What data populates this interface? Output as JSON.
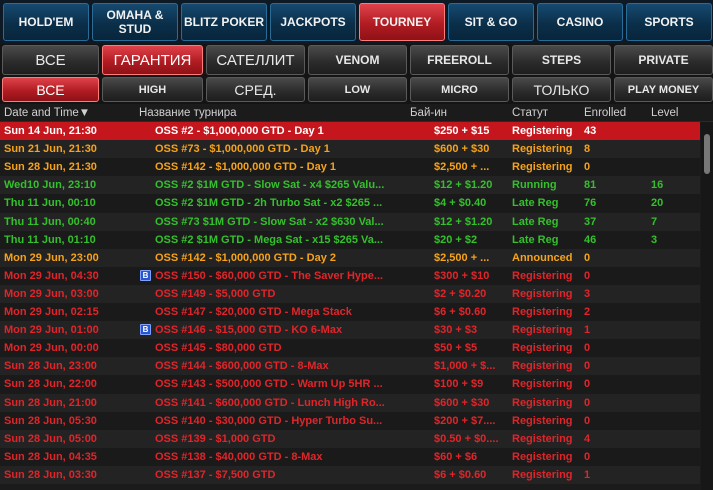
{
  "colors": {
    "orange": "#f6a21a",
    "green": "#34c02c",
    "red": "#e0252a",
    "white": "#ffffff"
  },
  "top_tabs": [
    {
      "label": "HOLD'EM",
      "active": false
    },
    {
      "label": "OMAHA & STUD",
      "active": false
    },
    {
      "label": "BLITZ POKER",
      "active": false
    },
    {
      "label": "JACKPOTS",
      "active": false
    },
    {
      "label": "TOURNEY",
      "active": true
    },
    {
      "label": "SIT & GO",
      "active": false
    },
    {
      "label": "CASINO",
      "active": false
    },
    {
      "label": "SPORTS",
      "active": false
    }
  ],
  "filters_row1": [
    {
      "label": "ВСЕ",
      "active": false,
      "big": true
    },
    {
      "label": "ГАРАНТИЯ",
      "active": true,
      "big": true
    },
    {
      "label": "САТЕЛЛИТ",
      "active": false,
      "big": true
    },
    {
      "label": "VENOM",
      "active": false,
      "big": false
    },
    {
      "label": "FREEROLL",
      "active": false,
      "big": false
    },
    {
      "label": "STEPS",
      "active": false,
      "big": false
    },
    {
      "label": "PRIVATE",
      "active": false,
      "big": false
    }
  ],
  "filters_row2": [
    {
      "label": "ВСЕ",
      "active": true,
      "big": true
    },
    {
      "label": "HIGH",
      "active": false,
      "big": false
    },
    {
      "label": "СРЕД.",
      "active": false,
      "big": true
    },
    {
      "label": "LOW",
      "active": false,
      "big": false
    },
    {
      "label": "MICRO",
      "active": false,
      "big": false
    },
    {
      "label": "ТОЛЬКО",
      "active": false,
      "big": true
    },
    {
      "label": "PLAY MONEY",
      "active": false,
      "big": false
    }
  ],
  "table": {
    "headers": {
      "date": "Date and Time▼",
      "name": "Название турнира",
      "buyin": "Бай-ин",
      "status": "Статут",
      "enrolled": "Enrolled",
      "level": "Level"
    },
    "rows": [
      {
        "date": "Sun 14 Jun, 21:30",
        "badge": "",
        "name": "OSS #2 - $1,000,000 GTD - Day 1",
        "buyin": "$250 + $15",
        "status": "Registering",
        "enrolled": "43",
        "level": "",
        "color": "white",
        "selected": true
      },
      {
        "date": "Sun 21 Jun, 21:30",
        "badge": "",
        "name": "OSS #73 - $1,000,000 GTD - Day 1",
        "buyin": "$600 + $30",
        "status": "Registering",
        "enrolled": "8",
        "level": "",
        "color": "orange"
      },
      {
        "date": "Sun 28 Jun, 21:30",
        "badge": "",
        "name": "OSS #142 - $1,000,000 GTD - Day 1",
        "buyin": "$2,500 + ...",
        "status": "Registering",
        "enrolled": "0",
        "level": "",
        "color": "orange"
      },
      {
        "date": "Wed10 Jun, 23:10",
        "badge": "",
        "name": "OSS #2 $1M GTD - Slow Sat - x4 $265 Valu...",
        "buyin": "$12 + $1.20",
        "status": "Running",
        "enrolled": "81",
        "level": "16",
        "color": "green"
      },
      {
        "date": "Thu 11 Jun, 00:10",
        "badge": "",
        "name": "OSS #2 $1M GTD - 2h Turbo Sat - x2 $265 ...",
        "buyin": "$4 + $0.40",
        "status": "Late Reg",
        "enrolled": "76",
        "level": "20",
        "color": "green"
      },
      {
        "date": "Thu 11 Jun, 00:40",
        "badge": "",
        "name": "OSS #73 $1M GTD - Slow Sat - x2 $630 Val...",
        "buyin": "$12 + $1.20",
        "status": "Late Reg",
        "enrolled": "37",
        "level": "7",
        "color": "green"
      },
      {
        "date": "Thu 11 Jun, 01:10",
        "badge": "",
        "name": "OSS #2 $1M GTD - Mega Sat - x15 $265 Va...",
        "buyin": "$20 + $2",
        "status": "Late Reg",
        "enrolled": "46",
        "level": "3",
        "color": "green"
      },
      {
        "date": "Mon 29 Jun, 23:00",
        "badge": "",
        "name": "OSS #142 - $1,000,000 GTD - Day 2",
        "buyin": "$2,500 + ...",
        "status": "Announced",
        "enrolled": "0",
        "level": "",
        "color": "orange"
      },
      {
        "date": "Mon 29 Jun, 04:30",
        "badge": "B",
        "name": "OSS #150 - $60,000 GTD - The Saver Hype...",
        "buyin": "$300 + $10",
        "status": "Registering",
        "enrolled": "0",
        "level": "",
        "color": "red"
      },
      {
        "date": "Mon 29 Jun, 03:00",
        "badge": "",
        "name": "OSS #149 - $5,000 GTD",
        "buyin": "$2 + $0.20",
        "status": "Registering",
        "enrolled": "3",
        "level": "",
        "color": "red"
      },
      {
        "date": "Mon 29 Jun, 02:15",
        "badge": "",
        "name": "OSS #147 - $20,000 GTD - Mega Stack",
        "buyin": "$6 + $0.60",
        "status": "Registering",
        "enrolled": "2",
        "level": "",
        "color": "red"
      },
      {
        "date": "Mon 29 Jun, 01:00",
        "badge": "B",
        "name": "OSS #146 - $15,000 GTD - KO 6-Max",
        "buyin": "$30 + $3",
        "status": "Registering",
        "enrolled": "1",
        "level": "",
        "color": "red"
      },
      {
        "date": "Mon 29 Jun, 00:00",
        "badge": "",
        "name": "OSS #145 - $80,000 GTD",
        "buyin": "$50 + $5",
        "status": "Registering",
        "enrolled": "0",
        "level": "",
        "color": "red"
      },
      {
        "date": "Sun 28 Jun, 23:00",
        "badge": "",
        "name": "OSS #144 - $600,000 GTD - 8-Max",
        "buyin": "$1,000 + $...",
        "status": "Registering",
        "enrolled": "0",
        "level": "",
        "color": "red"
      },
      {
        "date": "Sun 28 Jun, 22:00",
        "badge": "",
        "name": "OSS #143 - $500,000 GTD - Warm Up 5HR ...",
        "buyin": "$100 + $9",
        "status": "Registering",
        "enrolled": "0",
        "level": "",
        "color": "red"
      },
      {
        "date": "Sun 28 Jun, 21:00",
        "badge": "",
        "name": "OSS #141 - $600,000 GTD - Lunch High Ro...",
        "buyin": "$600 + $30",
        "status": "Registering",
        "enrolled": "0",
        "level": "",
        "color": "red"
      },
      {
        "date": "Sun 28 Jun, 05:30",
        "badge": "",
        "name": "OSS #140 - $30,000 GTD - Hyper Turbo Su...",
        "buyin": "$200 + $7....",
        "status": "Registering",
        "enrolled": "0",
        "level": "",
        "color": "red"
      },
      {
        "date": "Sun 28 Jun, 05:00",
        "badge": "",
        "name": "OSS #139 - $1,000 GTD",
        "buyin": "$0.50 + $0....",
        "status": "Registering",
        "enrolled": "4",
        "level": "",
        "color": "red"
      },
      {
        "date": "Sun 28 Jun, 04:35",
        "badge": "",
        "name": "OSS #138 - $40,000 GTD - 8-Max",
        "buyin": "$60 + $6",
        "status": "Registering",
        "enrolled": "0",
        "level": "",
        "color": "red"
      },
      {
        "date": "Sun 28 Jun, 03:30",
        "badge": "",
        "name": "OSS #137 - $7,500 GTD",
        "buyin": "$6 + $0.60",
        "status": "Registering",
        "enrolled": "1",
        "level": "",
        "color": "red"
      }
    ]
  }
}
